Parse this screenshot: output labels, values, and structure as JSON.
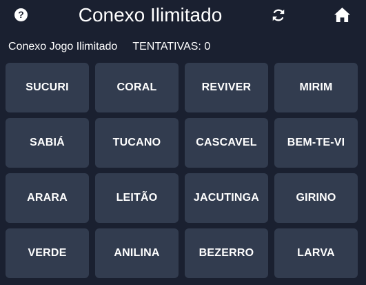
{
  "header": {
    "help_icon": "question-circle-icon",
    "help_glyph": "?",
    "title": "Conexo Ilimitado",
    "refresh_icon": "refresh-icon",
    "home_icon": "home-icon"
  },
  "subbar": {
    "mode_label": "Conexo Jogo Ilimitado",
    "attempts_label": "TENTATIVAS: 0"
  },
  "words": [
    "SUCURI",
    "CORAL",
    "REVIVER",
    "MIRIM",
    "SABIÁ",
    "TUCANO",
    "CASCAVEL",
    "BEM-TE-VI",
    "ARARA",
    "LEITÃO",
    "JACUTINGA",
    "GIRINO",
    "VERDE",
    "ANILINA",
    "BEZERRO",
    "LARVA"
  ],
  "colors": {
    "background": "#1a2030",
    "tile": "#323c4f",
    "text": "#ffffff"
  }
}
